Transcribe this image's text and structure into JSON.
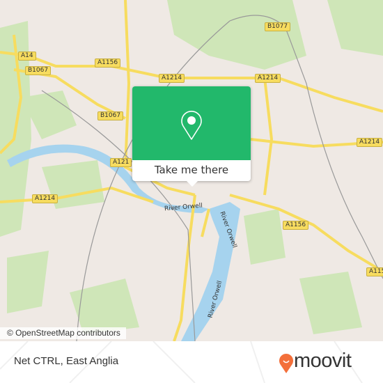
{
  "map": {
    "road_labels": [
      "A14",
      "B1077",
      "A1156",
      "A1214",
      "A1214",
      "B1067",
      "B1067",
      "A121",
      "A1214",
      "A1214",
      "A1156",
      "A115"
    ],
    "river_labels": [
      "River Orwell",
      "River Orwell",
      "River Orwell"
    ],
    "attribution": "© OpenStreetMap contributors",
    "colors": {
      "land": "#efe9e4",
      "park": "#cfe6b8",
      "water": "#a6d3ee",
      "road": "#f7dc5f"
    }
  },
  "popup": {
    "icon": "map-pin-icon",
    "button_label": "Take me there",
    "color": "#22b86b"
  },
  "footer": {
    "place_name": "Net CTRL, East Anglia",
    "logo_text": "moovit",
    "logo_color": "#f36f3a"
  }
}
